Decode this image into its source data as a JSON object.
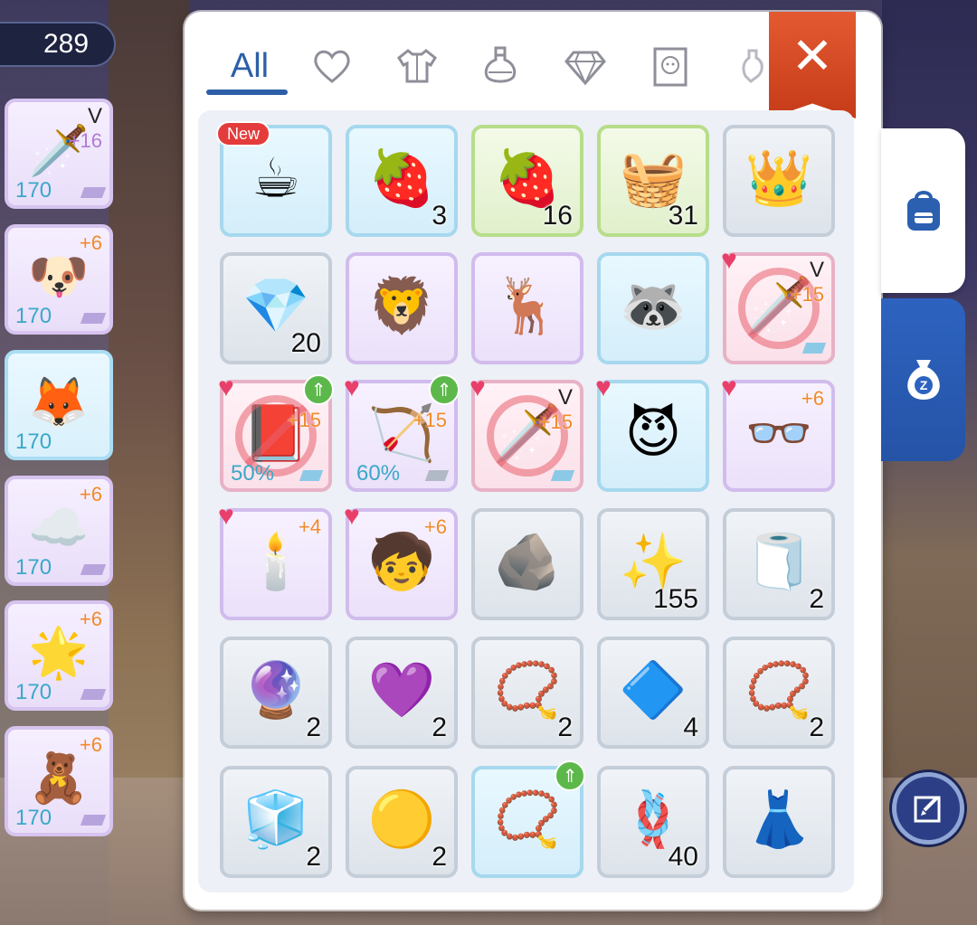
{
  "currency": {
    "amount": "289"
  },
  "tabs": {
    "all_label": "All",
    "icons": [
      "heart-icon",
      "armor-icon",
      "potion-icon",
      "gem-icon",
      "card-icon",
      "misc-icon"
    ]
  },
  "close_label": "✕",
  "side_equipment": [
    {
      "level": "170",
      "plus": "+16",
      "mark": "V",
      "art": "🗡️",
      "color": "purple"
    },
    {
      "level": "170",
      "plus": "+6",
      "mark": "",
      "art": "🐶",
      "color": "purple"
    },
    {
      "level": "170",
      "plus": "",
      "mark": "",
      "art": "🦊",
      "color": "blue"
    },
    {
      "level": "170",
      "plus": "+6",
      "mark": "",
      "art": "☁️",
      "color": "purple"
    },
    {
      "level": "170",
      "plus": "+6",
      "mark": "",
      "art": "🌟",
      "color": "purple"
    },
    {
      "level": "170",
      "plus": "+6",
      "mark": "",
      "art": "🧸",
      "color": "purple"
    }
  ],
  "inventory": [
    {
      "name": "strawberry-cup",
      "art": "☕",
      "count": "",
      "badge": "New",
      "color": "blue"
    },
    {
      "name": "strawberry-wand",
      "art": "🍓",
      "count": "3",
      "color": "blue"
    },
    {
      "name": "strawberry-hat",
      "art": "🍓",
      "count": "16",
      "color": "green"
    },
    {
      "name": "strawberry-basket",
      "art": "🧺",
      "count": "31",
      "color": "green"
    },
    {
      "name": "golden-hat",
      "art": "👑",
      "count": "",
      "color": "gray"
    },
    {
      "name": "pink-crystal",
      "art": "💎",
      "count": "20",
      "color": "gray"
    },
    {
      "name": "lion-card",
      "art": "🦁",
      "count": "",
      "color": "purple"
    },
    {
      "name": "deer-card",
      "art": "🦌",
      "count": "",
      "color": "purple"
    },
    {
      "name": "raccoon-card",
      "art": "🦝",
      "count": "",
      "color": "blue"
    },
    {
      "name": "blocked-sword",
      "art": "🗡️",
      "count": "",
      "plus": "+15",
      "mark": "V",
      "heart": true,
      "blocked": true,
      "color": "pink"
    },
    {
      "name": "blocked-book",
      "art": "📕",
      "pct": "50%",
      "plus": "+15",
      "heart": true,
      "upgrade": true,
      "blocked": true,
      "color": "pink"
    },
    {
      "name": "crossbow",
      "art": "🏹",
      "pct": "60%",
      "plus": "+15",
      "heart": true,
      "upgrade": true,
      "color": "purple"
    },
    {
      "name": "blocked-sword-2",
      "art": "🗡️",
      "plus": "+15",
      "mark": "V",
      "heart": true,
      "blocked": true,
      "color": "pink"
    },
    {
      "name": "red-horns",
      "art": "😈",
      "heart": true,
      "color": "blue"
    },
    {
      "name": "star-glasses",
      "art": "👓",
      "plus": "+6",
      "heart": true,
      "color": "purple"
    },
    {
      "name": "chandelier",
      "art": "🕯️",
      "plus": "+4",
      "heart": true,
      "color": "purple"
    },
    {
      "name": "chibi-doll",
      "art": "🧒",
      "plus": "+6",
      "heart": true,
      "color": "purple"
    },
    {
      "name": "dark-dust",
      "art": "🪨",
      "count": "",
      "color": "gray"
    },
    {
      "name": "blue-star",
      "art": "✨",
      "count": "155",
      "color": "gray"
    },
    {
      "name": "cloth-scrap",
      "art": "🧻",
      "count": "2",
      "color": "gray"
    },
    {
      "name": "purple-orb",
      "art": "🔮",
      "count": "2",
      "color": "gray"
    },
    {
      "name": "amethyst",
      "art": "💜",
      "count": "2",
      "color": "gray"
    },
    {
      "name": "silver-pendant",
      "art": "📿",
      "count": "2",
      "color": "gray"
    },
    {
      "name": "blue-shard",
      "art": "🔷",
      "count": "4",
      "color": "gray"
    },
    {
      "name": "jewel-necklace",
      "art": "📿",
      "count": "2",
      "color": "gray"
    },
    {
      "name": "ice-crystal",
      "art": "🧊",
      "count": "2",
      "color": "gray"
    },
    {
      "name": "gold-nugget",
      "art": "🟡",
      "count": "2",
      "color": "gray"
    },
    {
      "name": "gem-necklace",
      "art": "📿",
      "count": "",
      "upgrade": true,
      "color": "blue"
    },
    {
      "name": "rope",
      "art": "🪢",
      "count": "40",
      "color": "gray"
    },
    {
      "name": "red-dress",
      "art": "👗",
      "count": "",
      "color": "gray"
    }
  ]
}
